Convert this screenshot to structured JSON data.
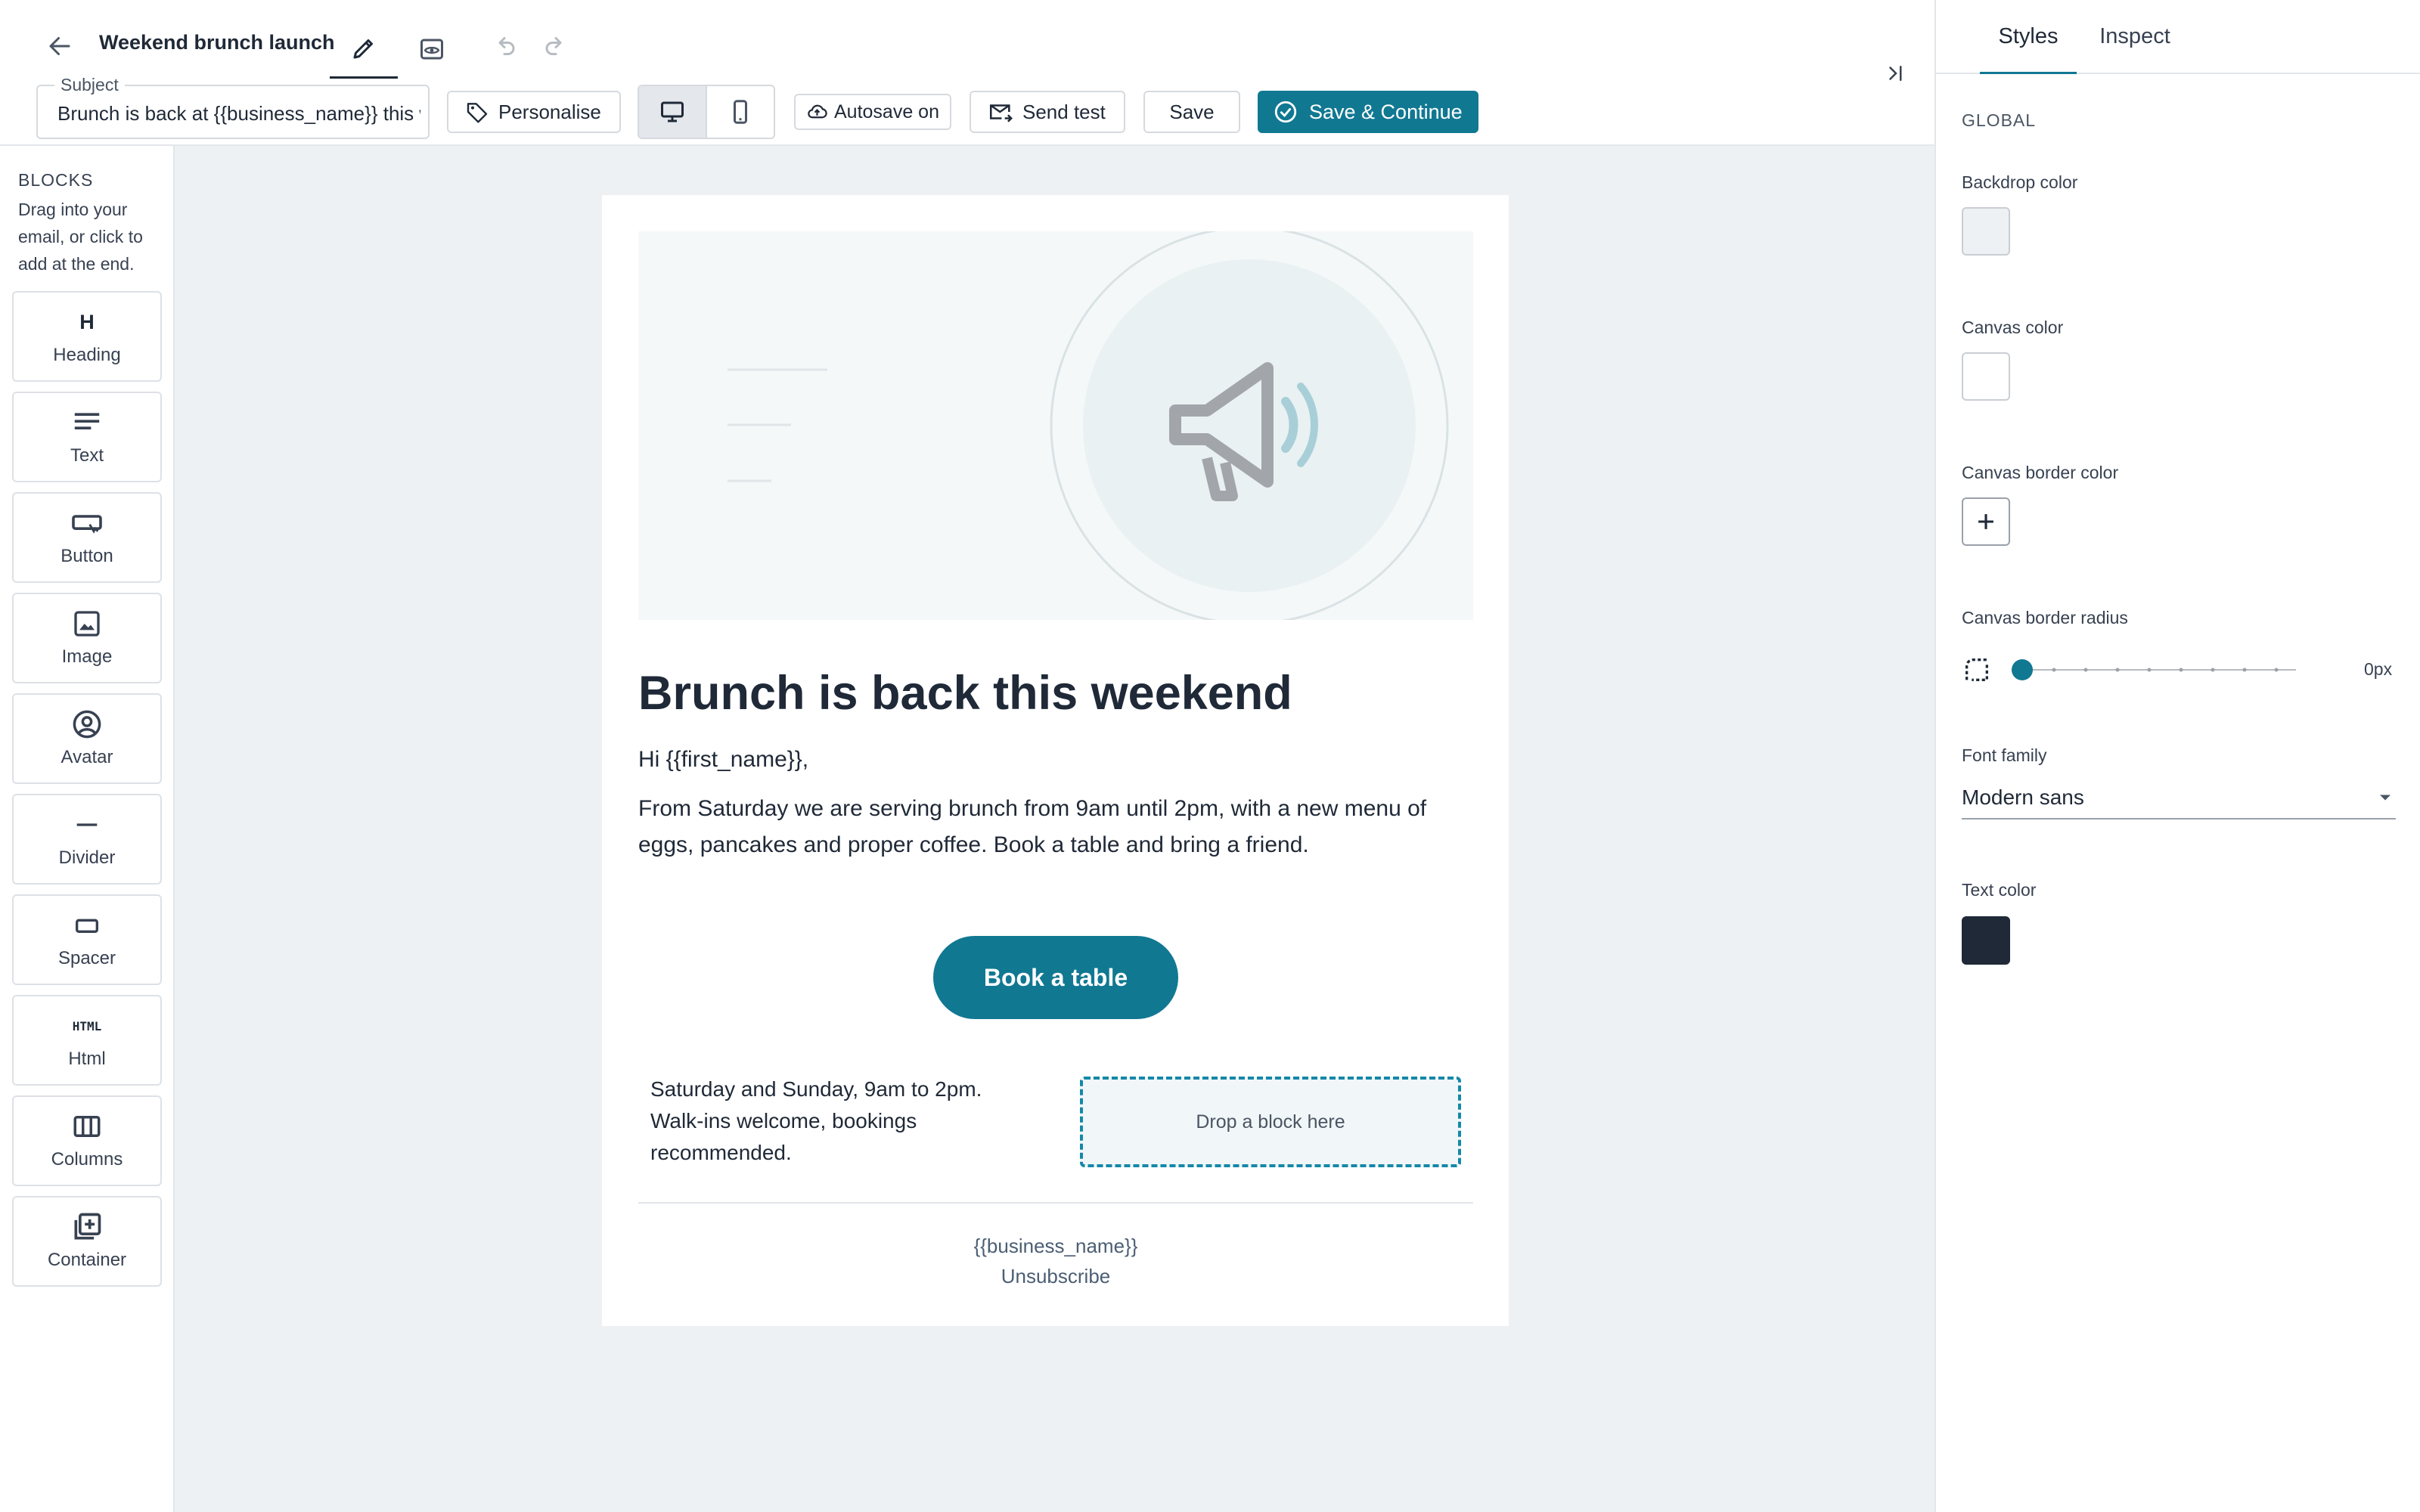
{
  "colors": {
    "accent": "#117892",
    "text": "#1f2937",
    "backdrop": "#eef1f4",
    "canvas": "#ffffff"
  },
  "header": {
    "title": "Weekend brunch launch",
    "icons": {
      "back": "arrow-left-icon",
      "edit": "pencil-icon",
      "preview": "eye-icon",
      "undo": "undo-icon",
      "redo": "redo-icon",
      "collapse": "collapse-panel-icon"
    }
  },
  "toolbar": {
    "subject_label": "Subject",
    "subject_value": "Brunch is back at {{business_name}} this weekend",
    "personalise": "Personalise",
    "autosave": "Autosave on",
    "send_test": "Send test",
    "save": "Save",
    "save_continue": "Save & Continue"
  },
  "blocks": {
    "title": "BLOCKS",
    "hint": "Drag into your email, or click to add at the end.",
    "items": [
      {
        "label": "Heading",
        "icon": "heading-icon"
      },
      {
        "label": "Text",
        "icon": "text-lines-icon"
      },
      {
        "label": "Button",
        "icon": "button-icon"
      },
      {
        "label": "Image",
        "icon": "image-icon"
      },
      {
        "label": "Avatar",
        "icon": "avatar-icon"
      },
      {
        "label": "Divider",
        "icon": "divider-icon"
      },
      {
        "label": "Spacer",
        "icon": "spacer-icon"
      },
      {
        "label": "Html",
        "icon": "html-icon"
      },
      {
        "label": "Columns",
        "icon": "columns-icon"
      },
      {
        "label": "Container",
        "icon": "container-icon"
      }
    ],
    "heading_glyph": "H",
    "html_glyph": "HTML"
  },
  "email": {
    "hero_icon": "megaphone-icon",
    "heading": "Brunch is back this weekend",
    "greeting": "Hi {{first_name}},",
    "body": "From Saturday we are serving brunch from 9am until 2pm, with a new menu of eggs, pancakes and proper coffee. Book a table and bring a friend.",
    "cta": "Book a table",
    "hours": "Saturday and Sunday, 9am to 2pm. Walk-ins welcome, bookings recommended.",
    "drop_zone": "Drop a block here",
    "footer_business": "{{business_name}}",
    "footer_unsubscribe": "Unsubscribe"
  },
  "styles_panel": {
    "tabs": [
      "Styles",
      "Inspect"
    ],
    "active_tab": "Styles",
    "section": "GLOBAL",
    "backdrop_label": "Backdrop color",
    "canvas_label": "Canvas color",
    "canvas_border_label": "Canvas border color",
    "radius_label": "Canvas border radius",
    "radius_value": "0px",
    "font_label": "Font family",
    "font_value": "Modern sans",
    "text_color_label": "Text color"
  }
}
